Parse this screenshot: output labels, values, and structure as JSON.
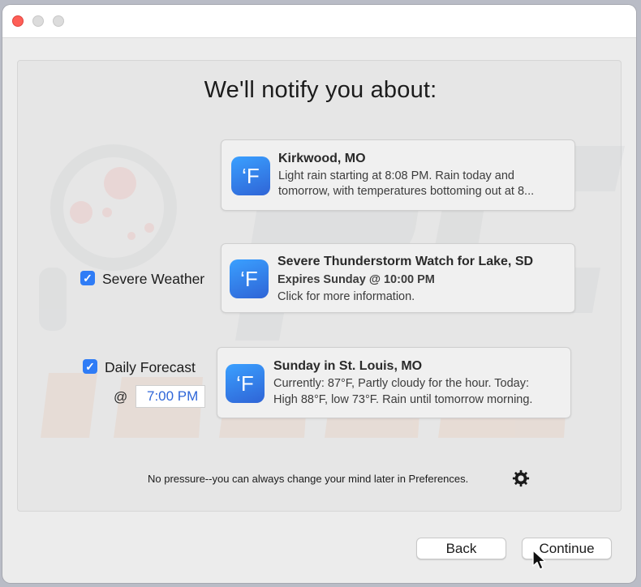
{
  "heading": "We'll notify you about:",
  "cards": [
    {
      "icon_glyph": "‘F",
      "title": "Kirkwood, MO",
      "line1": "Light rain starting at 8:08 PM. Rain today and",
      "line2": "tomorrow, with temperatures bottoming out at 8..."
    },
    {
      "icon_glyph": "‘F",
      "title": "Severe Thunderstorm Watch for Lake, SD",
      "line1": "Expires Sunday @ 10:00 PM",
      "line2": "Click for more information."
    },
    {
      "icon_glyph": "‘F",
      "title": "Sunday in St. Louis, MO",
      "line1": "Currently: 87°F, Partly cloudy for the hour. Today:",
      "line2": "High 88°F, low 73°F. Rain until tomorrow morning."
    }
  ],
  "options": {
    "severe_weather": {
      "label": "Severe Weather",
      "checked": true
    },
    "daily_forecast": {
      "label": "Daily Forecast",
      "checked": true,
      "at_label": "@",
      "time": "7:00 PM"
    }
  },
  "footer_note": "No pressure--you can always change your mind later in Preferences.",
  "buttons": {
    "back": "Back",
    "continue": "Continue"
  },
  "check_glyph": "✓",
  "icons": {
    "app": "forecast-app-icon",
    "gear": "gear-icon",
    "cursor": "mouse-cursor-icon"
  },
  "colors": {
    "accent": "#2f7cf6",
    "close_light": "#fe5f57",
    "time_text": "#2f66d8"
  }
}
